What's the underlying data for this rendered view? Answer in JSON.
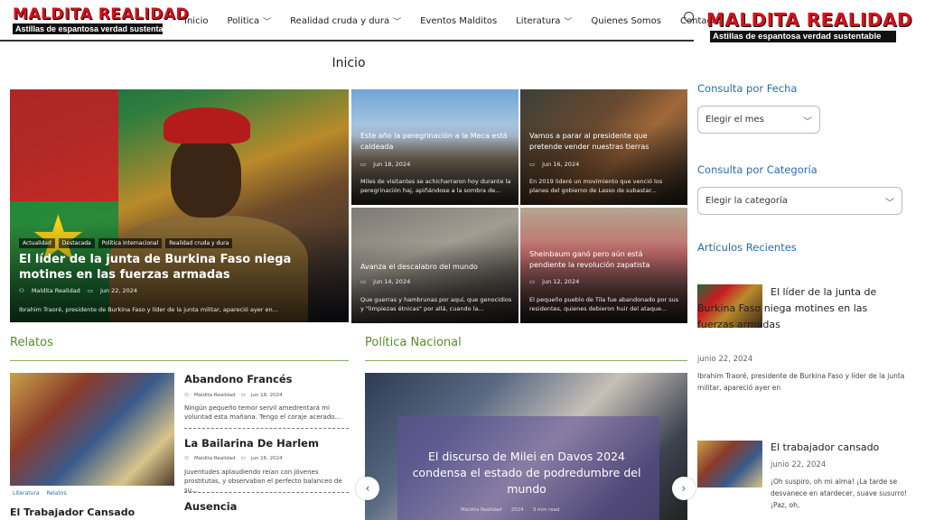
{
  "site": {
    "logo_top": "MALDITA REALIDAD",
    "logo_bottom": "Astillas de espantosa verdad sustentable"
  },
  "nav": {
    "items": [
      {
        "label": "Inicio",
        "has_submenu": false
      },
      {
        "label": "Politica",
        "has_submenu": true
      },
      {
        "label": "Realidad cruda y dura",
        "has_submenu": true
      },
      {
        "label": "Eventos Malditos",
        "has_submenu": false
      },
      {
        "label": "Literatura",
        "has_submenu": true
      },
      {
        "label": "Quienes Somos",
        "has_submenu": false
      },
      {
        "label": "Contacto",
        "has_submenu": false
      }
    ],
    "search_icon": "search-icon"
  },
  "page_title": "Inicio",
  "featured": {
    "main": {
      "tags": [
        "Actualidad",
        "Destacada",
        "Política Internacional",
        "Realidad cruda y dura"
      ],
      "title": "El líder de la junta de Burkina Faso niega motines en las fuerzas armadas",
      "author": "Maldita Realidad",
      "date": "jun 22, 2024",
      "excerpt": "Ibrahim Traoré, presidente de Burkina Faso y líder de la junta militar, apareció ayer en..."
    },
    "small": [
      {
        "title": "Este año la peregrinación a la Meca está caldeada",
        "date": "jun 18, 2024",
        "excerpt": "Miles de visitantes se achicharraron hoy durante la peregrinación haj, apiñándose a la sombra de..."
      },
      {
        "title": "Vamos a parar al presidente que pretende vender nuestras tierras",
        "date": "jun 16, 2024",
        "excerpt": "En 2019 lideré un movimiento que venció los planes del gobierno de Lasso de subastar..."
      },
      {
        "title": "Avanza el descalabro del mundo",
        "date": "jun 14, 2024",
        "excerpt": "Que guerras y hambrunas por aquí, que genocidios y \"limpiezas étnicas\" por allá, cuando la..."
      },
      {
        "title": "Sheinbaum ganó pero aún está pendiente la revolución zapatista",
        "date": "jun 12, 2024",
        "excerpt": "El pequeño pueblo de Tila fue abandonado por sus residentes, quienes debieron huir del ataque..."
      }
    ]
  },
  "relatos": {
    "heading": "Relatos",
    "feature": {
      "tags": [
        "Literatura",
        "Relatos"
      ],
      "title": "El Trabajador Cansado"
    },
    "posts": [
      {
        "title": "Abandono Francés",
        "author": "Maldita Realidad",
        "date": "jun 18, 2024",
        "excerpt": "Ningún pequeño temor servil amedrentará mi voluntad esta mañana. Tengo el coraje acerado..."
      },
      {
        "title": "La Bailarina De Harlem",
        "author": "Maldita Realidad",
        "date": "jun 16, 2024",
        "excerpt": "Juventudes aplaudiendo reían con jóvenes prostitutas, y observaban el perfecto balanceo de su..."
      },
      {
        "title": "Ausencia"
      }
    ]
  },
  "politica": {
    "heading": "Política Nacional",
    "slide": {
      "title": "El discurso de Milei en Davos 2024 condensa el estado de podredumbre del mundo",
      "author": "Maldita Realidad",
      "date": "2024",
      "read_time": "3 min read"
    },
    "prev": "‹",
    "next": "›"
  },
  "sidebar": {
    "fecha": {
      "heading": "Consulta por Fecha",
      "select_value": "Elegir el mes"
    },
    "categoria": {
      "heading": "Consulta por Categoría",
      "select_value": "Elegir la categoría"
    },
    "recientes": {
      "heading": "Artículos Recientes",
      "items": [
        {
          "title": "El líder de la junta de Burkina Faso niega motines en las fuerzas armadas",
          "date": "junio 22, 2024",
          "excerpt": "Ibrahim Traoré, presidente de Burkina Faso y líder de la junta militar, apareció ayer en"
        },
        {
          "title": "El trabajador cansado",
          "date": "junio 22, 2024",
          "excerpt": "¡Oh suspiro, oh mi alma! ¡La tarde se desvanece en atardecer, suave susurro! ¡Paz, oh,"
        }
      ]
    }
  }
}
